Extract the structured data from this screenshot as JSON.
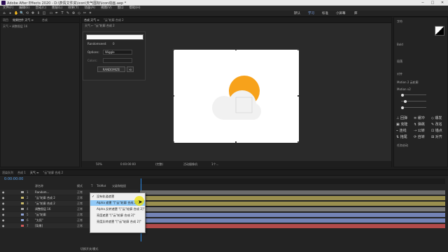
{
  "window": {
    "title": "Adobe After Effects 2020 - D:\\表情文件夹\\icon\\天气图标\\icon动画.aep *",
    "controls": [
      "─",
      "□",
      "✕"
    ]
  },
  "menu": [
    "文件(F)",
    "编辑(E)",
    "合成(C)",
    "图层(L)",
    "效果(T)",
    "动画(A)",
    "视图(V)",
    "窗口",
    "帮助(H)"
  ],
  "toolbar": {
    "tools": [
      "home-icon",
      "selection-icon",
      "hand-icon",
      "zoom-icon",
      "orbit-icon",
      "track-icon",
      "dolly-icon",
      "pan-icon",
      "rect-icon",
      "pen-icon",
      "type-icon",
      "brush-icon",
      "stamp-icon",
      "eraser-icon",
      "roto-icon",
      "puppet-icon"
    ],
    "glyphs": [
      "⌂",
      "▸",
      "✋",
      "🔍",
      "⟲",
      "✥",
      "⇕",
      "◫",
      "▭",
      "✒",
      "T",
      "✎",
      "⊕",
      "◇",
      "✂",
      "✶"
    ],
    "snap_label": "",
    "workspace": [
      "默认",
      "学习",
      "标准",
      "小屏幕",
      "库"
    ]
  },
  "project_panel": {
    "tabs": [
      "项目",
      "效果控件 天气 ≡",
      "",
      "合成"
    ],
    "header": "天气 • 调整图层 16"
  },
  "effect_dialog": {
    "randomseed_label": "Randomseed:",
    "randomseed_value": "0",
    "options_label": "Options:",
    "options_value": "Wiggle",
    "colors_label": "Colors:",
    "generate_label": "RANDOMIZE"
  },
  "comp_panel": {
    "tabs": [
      "合成 天气 ≡",
      "\"云\"轮廓 合成 2"
    ],
    "breadcrumb": [
      "天气",
      "\"云\"轮廓 合成 2"
    ],
    "zoom": "50%",
    "timecode": "0:00:00:00",
    "quality": "(完整)",
    "camera": "活动摄像机",
    "views": "1个..."
  },
  "right_panel": {
    "title": "字符",
    "font": "Bold",
    "sections": [
      "段落",
      "对齐",
      "Motion 2 云轮廓"
    ],
    "motion_label": "Motion v2",
    "buttons": [
      "⊥ 回弹",
      "≡ 缓冲",
      "◇ 爆发",
      "▣ 克隆",
      "↯ 弹跳",
      "✎ 改名",
      "⌁ 连线",
      "⇢ 公转",
      "⊡ 锚点",
      "⇅ 拖尾",
      "⟳ 自转",
      "⊞ 对齐"
    ],
    "footer": "任务启动"
  },
  "timeline": {
    "tabs": [
      "渲染队列",
      "合成 1",
      "天气 ≡",
      "\"云\"轮廓 合成 2"
    ],
    "timecode": "0:00:00:00",
    "columns": [
      "源名称",
      "模式",
      "T",
      "TrkMat",
      "父级和链接"
    ],
    "layers": [
      {
        "num": "1",
        "name": "Random...",
        "mode": "正常",
        "color": "#a8a8a8"
      },
      {
        "num": "2",
        "name": "\"云\"轮廓 合成 2",
        "mode": "正常",
        "color": "#c9b96a"
      },
      {
        "num": "3",
        "name": "\"云\"轮廓 合成 2",
        "mode": "正常",
        "color": "#c9b96a"
      },
      {
        "num": "4",
        "name": "调整图层 16",
        "mode": "正常",
        "color": "#a8a8a8"
      },
      {
        "num": "5",
        "name": "\"云\"轮廓",
        "mode": "正常",
        "color": "#8fa3d6"
      },
      {
        "num": "6",
        "name": "\"太阳\"",
        "mode": "正常",
        "color": "#8fa3d6"
      },
      {
        "num": "7",
        "name": "[背景]",
        "mode": "正常",
        "color": "#d05a5a"
      }
    ],
    "bar_colors": [
      "#6b6b6b",
      "#9a8f4f",
      "#9a8f4f",
      "#7a7a7a",
      "#7383b6",
      "#7383b6",
      "#b24b4b"
    ],
    "footer_label": "切换开关/模式"
  },
  "context_menu": {
    "items": [
      {
        "label": "没有轨道遮罩",
        "checked": true
      },
      {
        "label": "Alpha 遮罩 \"[\"云\"轮廓 合成 2]\"",
        "checked": false,
        "highlight": true
      },
      {
        "label": "Alpha 反转遮罩 \"[\"云\"轮廓 合成 2]\"",
        "checked": false
      },
      {
        "label": "亮度遮罩 \"[\"云\"轮廓 合成 2]\"",
        "checked": false
      },
      {
        "label": "亮度反转遮罩 \"[\"云\"轮廓 合成 2]\"",
        "checked": false
      }
    ]
  },
  "colors": {
    "sun": "#f7a21b",
    "cloud": "#f1f1f1",
    "accent": "#2d8ceb",
    "cursor": "#f2e200"
  }
}
